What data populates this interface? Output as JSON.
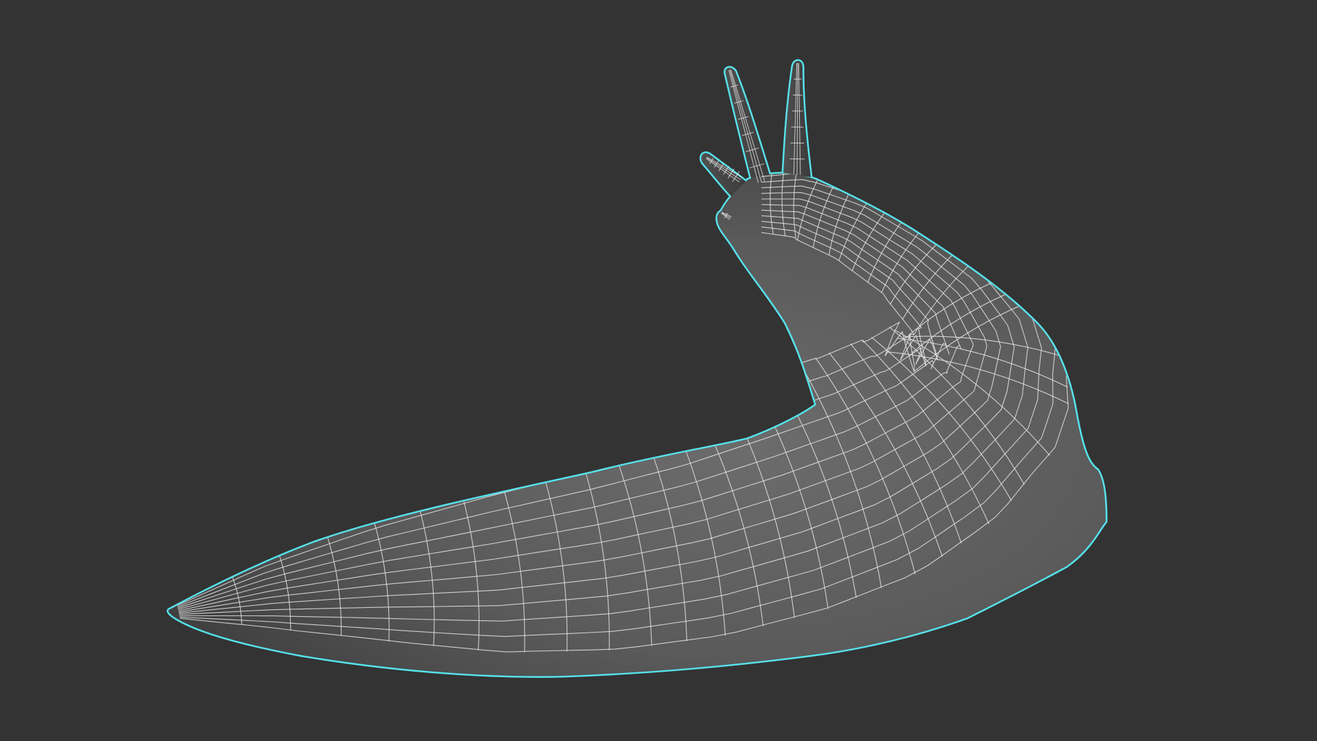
{
  "viewport": {
    "background_color": "#333333",
    "selection_outline_color": "#56e3ec",
    "wire_color": "#e8e8e8",
    "shade_light": "#6e6e6e",
    "shade_dark": "#2c2c2c",
    "display_mode": "shaded-wireframe",
    "model_selected": true
  },
  "model": {
    "subject": "slug-mesh"
  }
}
